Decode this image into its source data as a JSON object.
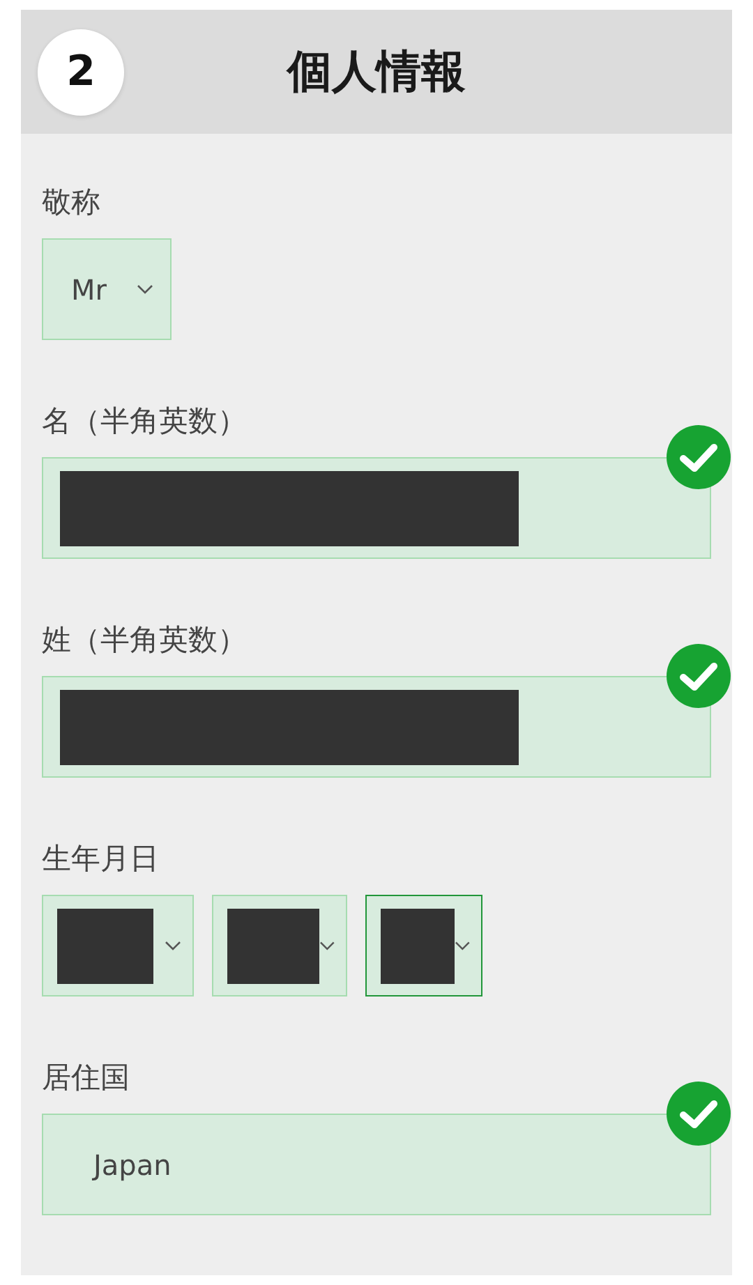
{
  "header": {
    "step": "2",
    "title": "個人情報"
  },
  "fields": [
    {
      "kind": "select",
      "label": "敬称",
      "value": "Mr"
    },
    {
      "kind": "text",
      "label": "名（半角英数）",
      "redacted": true,
      "valid": true
    },
    {
      "kind": "text",
      "label": "姓（半角英数）",
      "redacted": true,
      "valid": true
    },
    {
      "kind": "date",
      "label": "生年月日",
      "parts": [
        {
          "redacted": true,
          "focused": false
        },
        {
          "redacted": true,
          "focused": false
        },
        {
          "redacted": true,
          "focused": true
        }
      ]
    },
    {
      "kind": "text",
      "label": "居住国",
      "value": "Japan",
      "valid": true
    }
  ]
}
